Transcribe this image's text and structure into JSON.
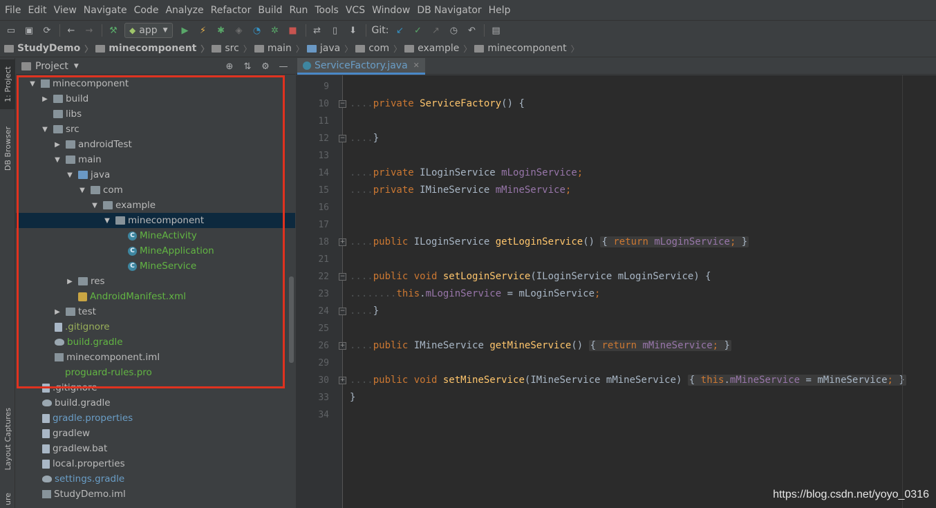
{
  "menu": [
    "File",
    "Edit",
    "View",
    "Navigate",
    "Code",
    "Analyze",
    "Refactor",
    "Build",
    "Run",
    "Tools",
    "VCS",
    "Window",
    "DB Navigator",
    "Help"
  ],
  "toolbar": {
    "run_config": "app",
    "git_label": "Git:"
  },
  "breadcrumbs": [
    "StudyDemo",
    "minecomponent",
    "src",
    "main",
    "java",
    "com",
    "example",
    "minecomponent"
  ],
  "left_tabs": [
    "1: Project",
    "DB Browser",
    "Layout Captures",
    "ure"
  ],
  "project_panel": {
    "title": "Project"
  },
  "tree": [
    {
      "label": "minecomponent",
      "toggle": "▼",
      "icon": "module"
    },
    {
      "label": "build",
      "toggle": "▶",
      "icon": "folder"
    },
    {
      "label": "libs",
      "toggle": "",
      "icon": "folder"
    },
    {
      "label": "src",
      "toggle": "▼",
      "icon": "folder"
    },
    {
      "label": "androidTest",
      "toggle": "▶",
      "icon": "folder"
    },
    {
      "label": "main",
      "toggle": "▼",
      "icon": "folder"
    },
    {
      "label": "java",
      "toggle": "▼",
      "icon": "folderblue"
    },
    {
      "label": "com",
      "toggle": "▼",
      "icon": "folder"
    },
    {
      "label": "example",
      "toggle": "▼",
      "icon": "folder"
    },
    {
      "label": "minecomponent",
      "toggle": "▼",
      "icon": "folder"
    },
    {
      "label": "MineActivity",
      "toggle": "",
      "icon": "cls"
    },
    {
      "label": "MineApplication",
      "toggle": "",
      "icon": "cls"
    },
    {
      "label": "MineService",
      "toggle": "",
      "icon": "cls"
    },
    {
      "label": "res",
      "toggle": "▶",
      "icon": "folder"
    },
    {
      "label": "AndroidManifest.xml",
      "toggle": "",
      "icon": "xml"
    },
    {
      "label": "test",
      "toggle": "▶",
      "icon": "folder"
    },
    {
      "label": ".gitignore",
      "toggle": "",
      "icon": "file"
    },
    {
      "label": "build.gradle",
      "toggle": "",
      "icon": "gradle"
    },
    {
      "label": "minecomponent.iml",
      "toggle": "",
      "icon": "module"
    },
    {
      "label": "proguard-rules.pro",
      "toggle": "",
      "icon": "file"
    },
    {
      "label": ".gitignore",
      "toggle": "",
      "icon": "file"
    },
    {
      "label": "build.gradle",
      "toggle": "",
      "icon": "gradle"
    },
    {
      "label": "gradle.properties",
      "toggle": "",
      "icon": "file"
    },
    {
      "label": "gradlew",
      "toggle": "",
      "icon": "file"
    },
    {
      "label": "gradlew.bat",
      "toggle": "",
      "icon": "file"
    },
    {
      "label": "local.properties",
      "toggle": "",
      "icon": "file"
    },
    {
      "label": "settings.gradle",
      "toggle": "",
      "icon": "gradle"
    },
    {
      "label": "StudyDemo.iml",
      "toggle": "",
      "icon": "module"
    }
  ],
  "editor": {
    "tab": "ServiceFactory.java",
    "line_numbers": [
      "9",
      "10",
      "11",
      "12",
      "13",
      "14",
      "15",
      "16",
      "17",
      "18",
      "21",
      "22",
      "23",
      "24",
      "25",
      "26",
      "29",
      "30",
      "33",
      "34"
    ]
  },
  "watermark": "https://blog.csdn.net/yoyo_0316"
}
